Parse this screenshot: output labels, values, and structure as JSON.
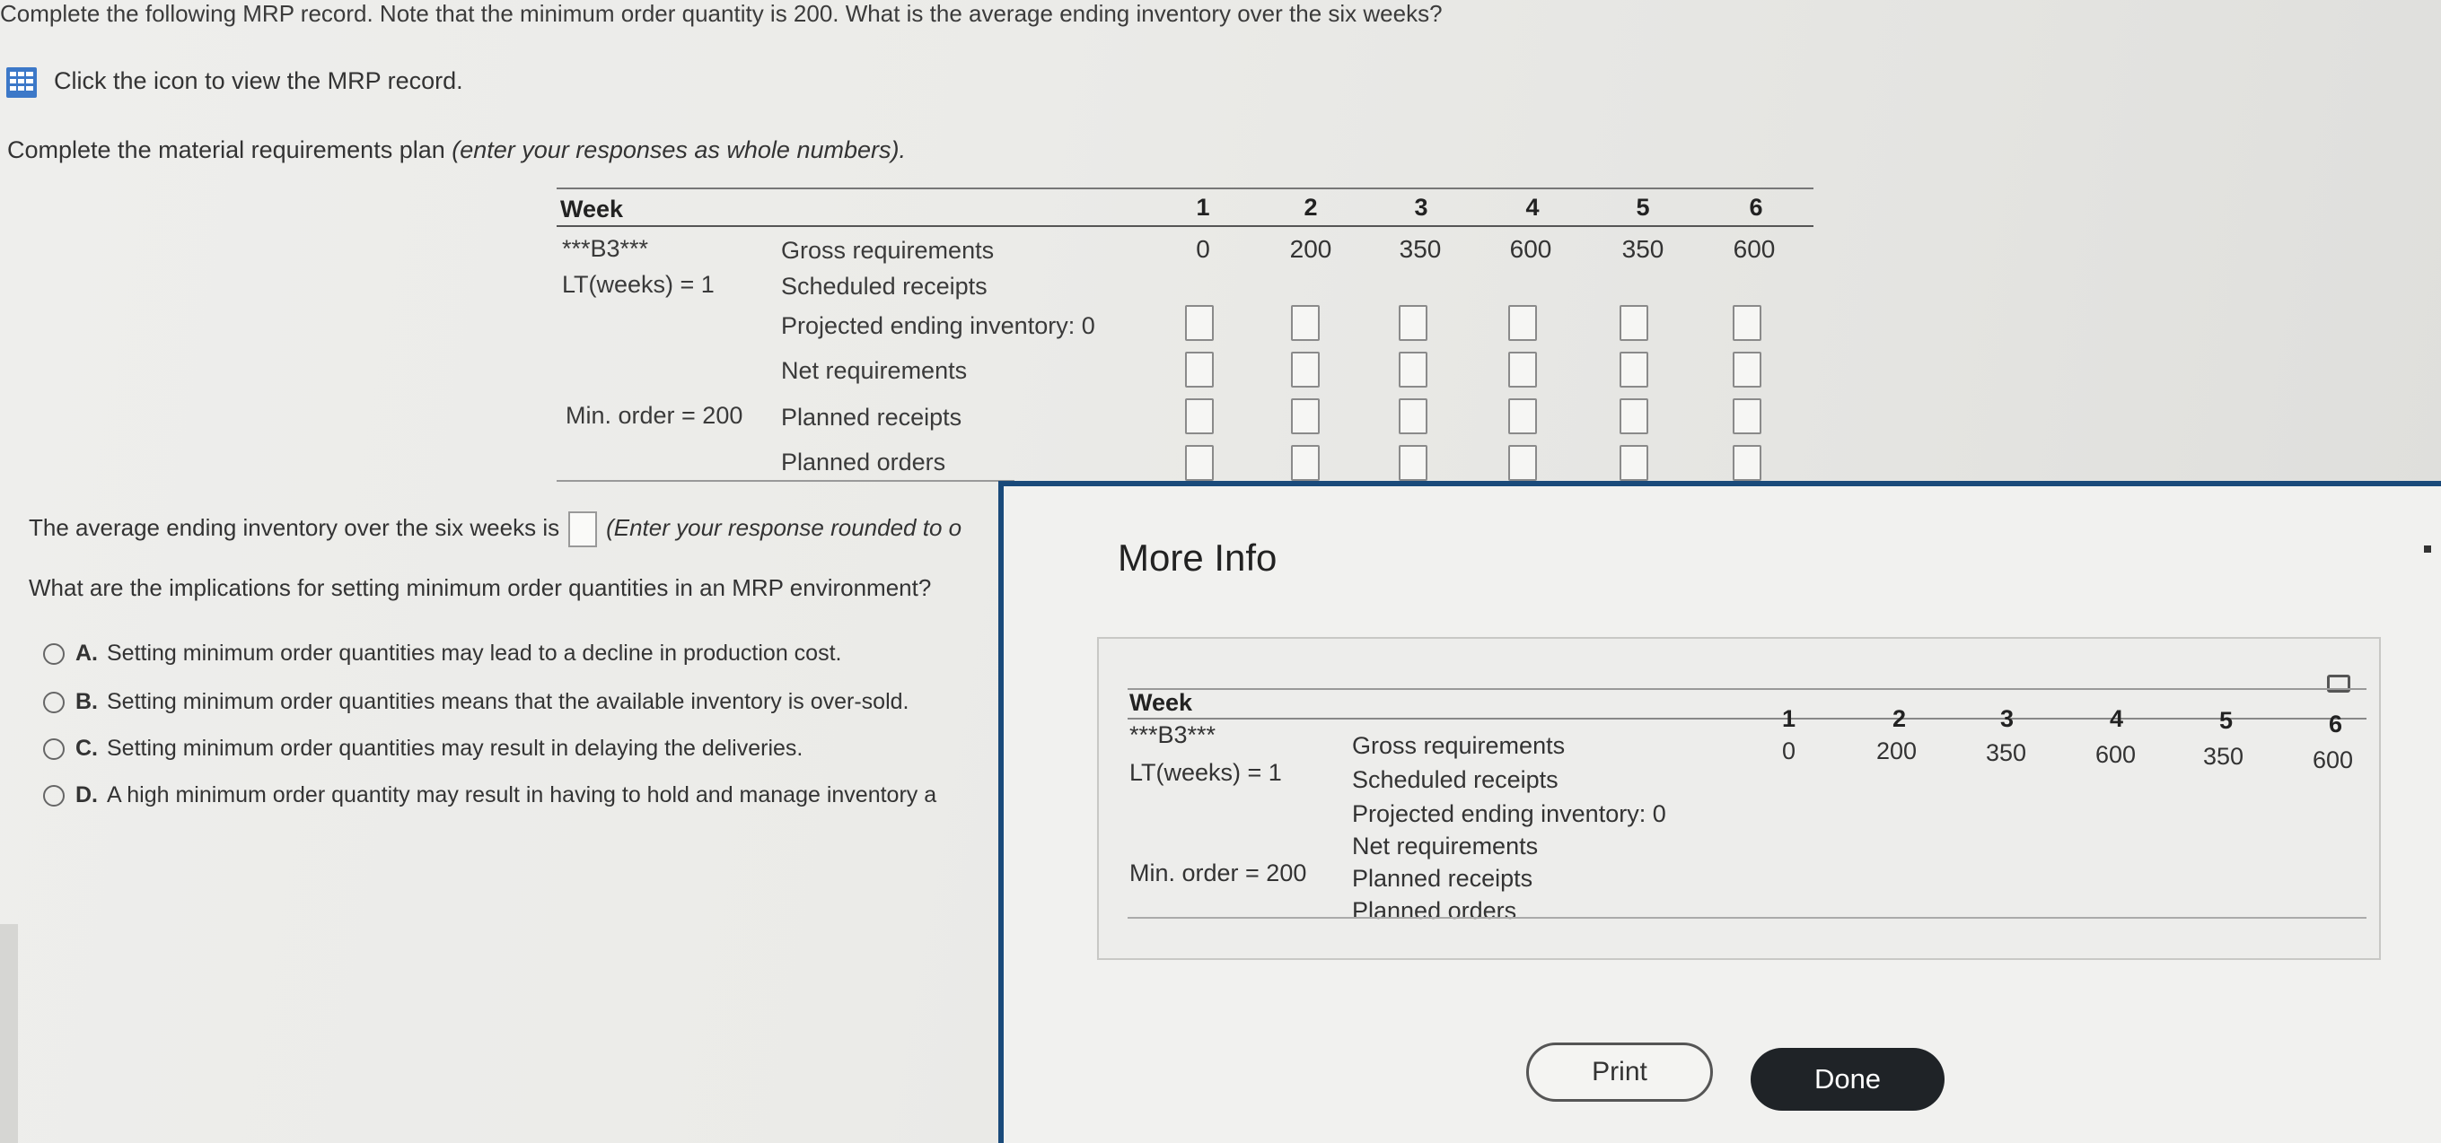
{
  "question": "Complete the following MRP record. Note that the minimum order quantity is 200. What is the average ending inventory over the six weeks?",
  "link_text": "Click the icon to view the MRP record.",
  "instruction": {
    "main": "Complete the material requirements plan ",
    "italic": "(enter your responses as whole numbers)."
  },
  "mrp": {
    "week_label": "Week",
    "item": "***B3***",
    "lead_time": "LT(weeks) = 1",
    "min_order": "Min. order = 200",
    "rows": [
      "Gross requirements",
      "Scheduled receipts",
      "Projected ending inventory: 0",
      "Net requirements",
      "Planned receipts",
      "Planned orders"
    ],
    "weeks": [
      "1",
      "2",
      "3",
      "4",
      "5",
      "6"
    ],
    "gross": [
      "0",
      "200",
      "350",
      "600",
      "350",
      "600"
    ]
  },
  "avg": {
    "before": "The average ending inventory over the six weeks is",
    "after": "(Enter your response rounded to o"
  },
  "implications_q": "What are the implications for setting minimum order quantities in an MRP environment?",
  "options": [
    {
      "letter": "A.",
      "text": "Setting minimum order quantities may  lead to a decline in production cost."
    },
    {
      "letter": "B.",
      "text": "Setting minimum order quantities means that the available inventory is over-sold."
    },
    {
      "letter": "C.",
      "text": "Setting minimum order quantities may result in delaying the deliveries."
    },
    {
      "letter": "D.",
      "text": "A high minimum order quantity may result in having to hold and manage inventory a"
    }
  ],
  "modal": {
    "title": "More Info",
    "print": "Print",
    "done": "Done"
  },
  "colors": {
    "modal_border": "#1a4a7a",
    "done_bg": "#1f2327"
  },
  "icons": [
    "grid-table-icon",
    "print-icon"
  ]
}
